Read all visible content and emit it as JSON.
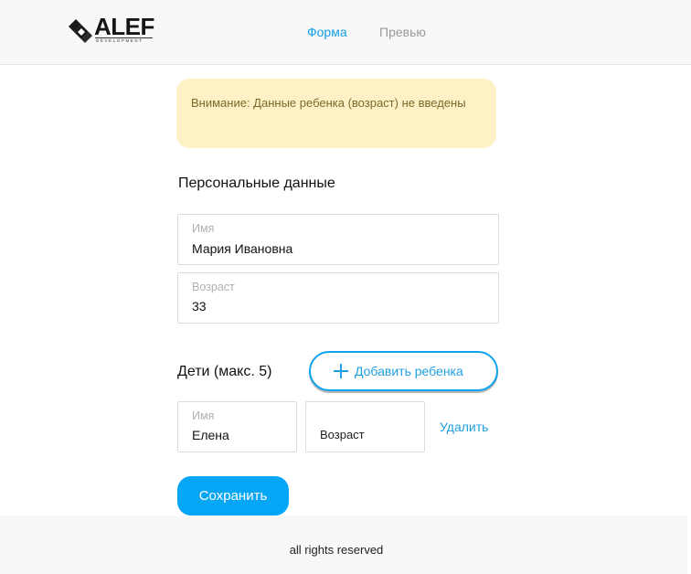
{
  "header": {
    "logo": {
      "name": "ALEF",
      "subtitle": "DEVELOPMENT"
    },
    "nav": {
      "form": "Форма",
      "preview": "Превью"
    },
    "active_color": "#14a0e6"
  },
  "warning": {
    "text": "Внимание: Данные ребенка (возраст) не введены"
  },
  "personal": {
    "title": "Персональные данные",
    "name_label": "Имя",
    "name_value": "Мария Ивановна",
    "age_label": "Возраст",
    "age_value": "33"
  },
  "children": {
    "title": "Дети (макс. 5)",
    "add_label": "Добавить ребенка",
    "items": [
      {
        "name_label": "Имя",
        "name_value": "Елена",
        "age_placeholder": "Возраст",
        "delete_label": "Удалить"
      }
    ]
  },
  "actions": {
    "save_label": "Сохранить"
  },
  "footer": {
    "text": "all rights reserved"
  },
  "colors": {
    "accent": "#06a6f7",
    "warning_bg": "#fef1c6",
    "link": "#1f9fe0"
  }
}
